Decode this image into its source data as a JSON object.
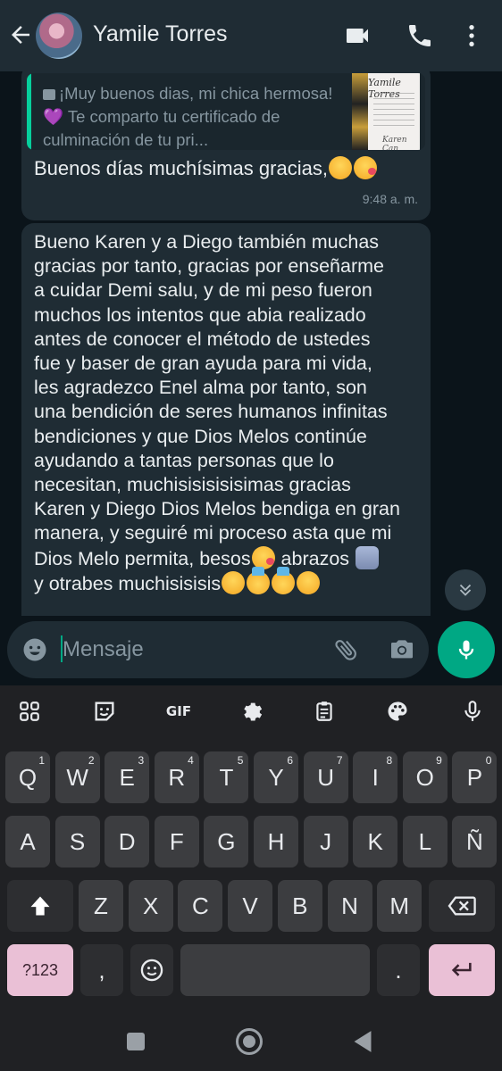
{
  "header": {
    "contact_name": "Yamile Torres",
    "icons": [
      "back-arrow-icon",
      "video-call-icon",
      "phone-icon",
      "more-vert-icon"
    ]
  },
  "messages": [
    {
      "quoted_text": "¡Muy buenos dias, mi chica hermosa!💜 Te comparto tu certificado de culminación de tu pri...",
      "quoted_thumb_title": "Yamile Torres",
      "quoted_thumb_signature": "Karen Can",
      "text": "Buenos días muchísimas gracias,",
      "time": "9:48 a. m."
    },
    {
      "lines": [
        "Bueno Karen y a Diego también muchas",
        "gracias por tanto, gracias por enseñarme",
        "a cuidar Demi salu, y de mi peso fueron",
        "muchos los intentos que abia realizado",
        "antes de conocer el método de ustedes",
        "fue y baser de gran ayuda para mi vida,",
        "les agradezco Enel alma por tanto, son",
        "una bendición de seres humanos infinitas",
        "bendiciones y que Dios Melos continúe",
        "ayudando a tantas personas que lo",
        "necesitan, muchisisisisisimas gracias",
        "Karen y Diego Dios Melos bendiga en gran",
        "manera, y seguiré mi proceso asta que mi"
      ],
      "line14_a": "Dios Melo permita,  besos",
      "line14_b": " abrazos ",
      "line15_a": "y otrabes muchisisisis"
    }
  ],
  "composer": {
    "placeholder": "Mensaje"
  },
  "keyboard": {
    "toolbar": [
      "apps-grid-icon",
      "sticker-icon",
      "GIF",
      "settings-icon",
      "clipboard-icon",
      "palette-icon",
      "voice-input-icon"
    ],
    "row1": [
      {
        "k": "Q",
        "n": "1"
      },
      {
        "k": "W",
        "n": "2"
      },
      {
        "k": "E",
        "n": "3"
      },
      {
        "k": "R",
        "n": "4"
      },
      {
        "k": "T",
        "n": "5"
      },
      {
        "k": "Y",
        "n": "6"
      },
      {
        "k": "U",
        "n": "7"
      },
      {
        "k": "I",
        "n": "8"
      },
      {
        "k": "O",
        "n": "9"
      },
      {
        "k": "P",
        "n": "0"
      }
    ],
    "row2": [
      "A",
      "S",
      "D",
      "F",
      "G",
      "H",
      "J",
      "K",
      "L",
      "Ñ"
    ],
    "row3": [
      "Z",
      "X",
      "C",
      "V",
      "B",
      "N",
      "M"
    ],
    "symbols_label": "?123",
    "comma": ",",
    "period": "."
  }
}
